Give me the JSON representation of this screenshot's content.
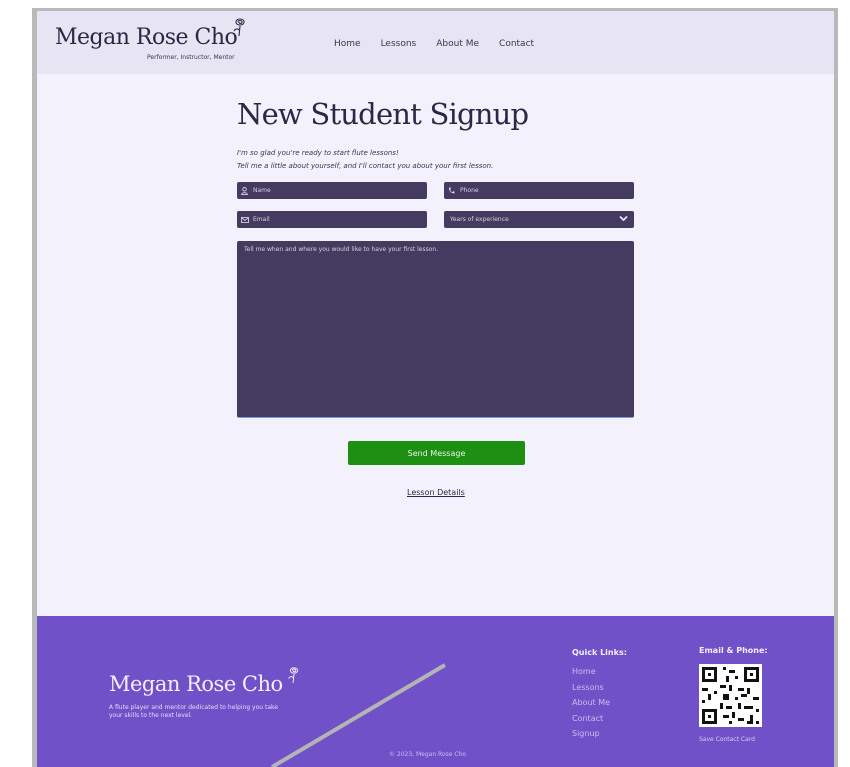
{
  "header": {
    "brand": "Megan Rose Cho",
    "tagline": "Performer, Instructor, Mentor",
    "nav": [
      "Home",
      "Lessons",
      "About Me",
      "Contact"
    ]
  },
  "main": {
    "title": "New Student Signup",
    "intro_line1": "I'm so glad you're ready to start flute lessons!",
    "intro_line2": "Tell me a little about yourself, and I'll contact you about your first lesson.",
    "fields": {
      "name_placeholder": "Name",
      "phone_placeholder": "Phone",
      "email_placeholder": "Email",
      "experience_selected": "Years of experience",
      "message_placeholder": "Tell me when and where you would like to have your first lesson."
    },
    "send_label": "Send Message",
    "lesson_details_link": "Lesson Details"
  },
  "footer": {
    "brand": "Megan Rose Cho",
    "description": "A flute player and mentor dedicated to helping you take your skills to the next level.",
    "quick_links_title": "Quick Links:",
    "quick_links": [
      "Home",
      "Lessons",
      "About Me",
      "Contact",
      "Signup"
    ],
    "email_phone_title": "Email & Phone:",
    "save_contact": "Save Contact Card",
    "copyright": "© 2023, Megan Rose Cho"
  },
  "colors": {
    "header_bg": "#e7e4f3",
    "field_bg": "#453a5f",
    "send_button": "#1d8f12",
    "footer_bg": "#7151c7"
  },
  "icons": [
    "rose-icon",
    "user-icon",
    "phone-icon",
    "envelope-icon",
    "chevron-down-icon",
    "qr-code-icon"
  ]
}
